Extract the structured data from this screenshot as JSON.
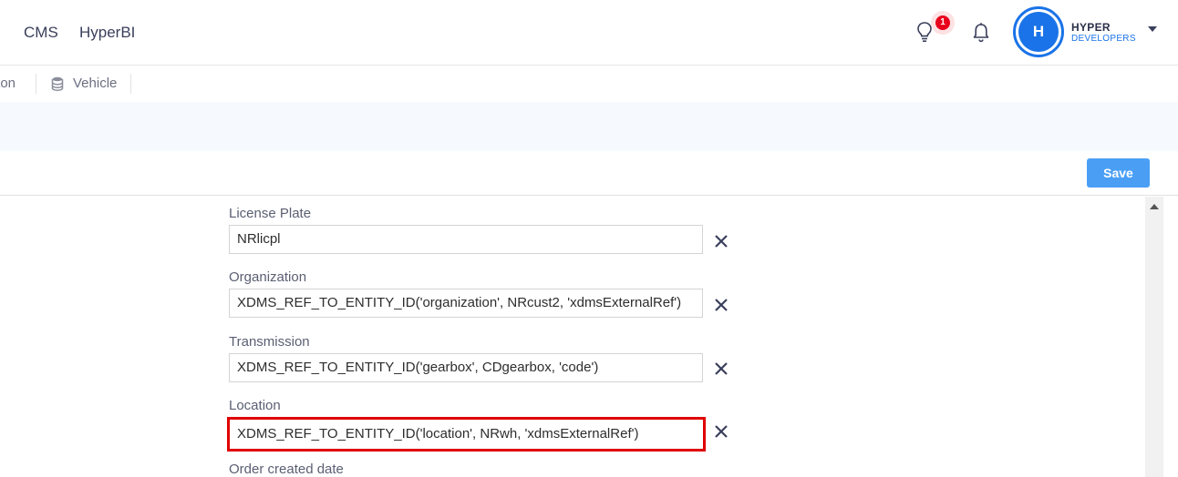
{
  "nav": {
    "links": [
      "CMS",
      "HyperBI"
    ],
    "notification_count": "1",
    "user_initial": "H",
    "brand_top": "HYPER",
    "brand_bottom": "DEVELOPERS"
  },
  "tabs": {
    "partial_tab": "tton",
    "vehicle": "Vehicle"
  },
  "toolbar": {
    "save_label": "Save"
  },
  "form": {
    "fields": [
      {
        "label": "License Plate",
        "value": "NRlicpl"
      },
      {
        "label": "Organization",
        "value": "XDMS_REF_TO_ENTITY_ID('organization', NRcust2, 'xdmsExternalRef')"
      },
      {
        "label": "Transmission",
        "value": "XDMS_REF_TO_ENTITY_ID('gearbox', CDgearbox, 'code')"
      },
      {
        "label": "Location",
        "value": "XDMS_REF_TO_ENTITY_ID('location', NRwh, 'xdmsExternalRef')"
      },
      {
        "label": "Order created date",
        "value": ""
      }
    ]
  },
  "colors": {
    "accent": "#1a73e8",
    "save_button": "#4a9ff5",
    "highlight_border": "#e00000",
    "badge": "#e8001c"
  },
  "icons": [
    "lightbulb-icon",
    "bell-icon",
    "chevron-down-icon",
    "database-icon",
    "close-icon"
  ]
}
